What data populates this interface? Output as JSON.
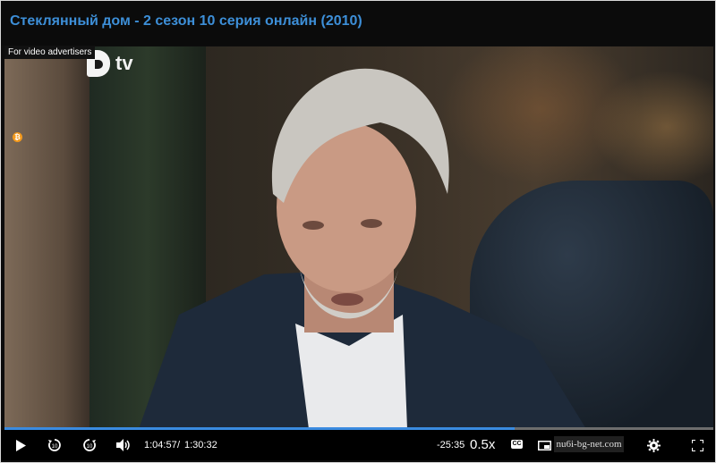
{
  "page": {
    "title": "Стеклянный дом - 2 сезон 10 серия онлайн (2010)"
  },
  "video": {
    "channel_logo": "tv",
    "ad_label": "For video advertisers",
    "bitcoin_badge": "₿",
    "progress_fraction": 0.72
  },
  "controls": {
    "play_icon": "play-icon",
    "rewind_icon": "rewind-10-icon",
    "forward_icon": "forward-10-icon",
    "volume_icon": "volume-icon",
    "current_time": "1:04:57",
    "separator": "/",
    "duration": "1:30:32",
    "remaining": "-25:35",
    "speed": "0.5x",
    "cc_label": "CC",
    "watermark": "nu6i-bg-net.com"
  },
  "colors": {
    "title": "#3d8fd8",
    "progress": "#3a8be0",
    "background": "#0b0b0b"
  }
}
